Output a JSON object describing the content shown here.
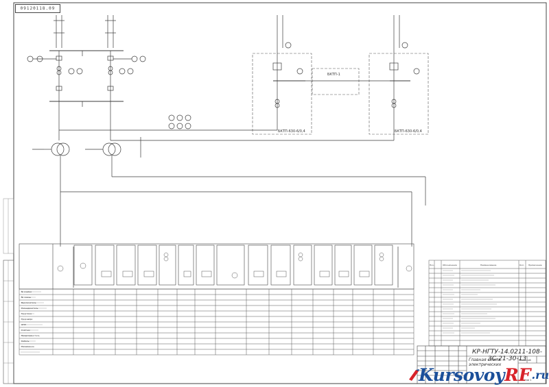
{
  "stamp": {
    "top_code": "09120118.09",
    "doc_number": "КР-НГТУ-14.0211-108-ЗС-21-30-13",
    "doc_title": "Главная схема электрических",
    "sheet_label": "Листов 1",
    "role_label": "Масштаб"
  },
  "boxes": {
    "kts_left": "БКТП-630-6/0,4",
    "kts_right": "БКТП-630-6/0,4",
    "kts_mid": "БКТП-1"
  },
  "watermark": {
    "main": "Kursovoy",
    "accent": "RF",
    "suffix": ".ru"
  },
  "spec_table": {
    "headers": [
      "Поз.",
      "Обозначение",
      "Наименование",
      "Кол.",
      "Примечание"
    ]
  },
  "panel_table": {
    "row_labels": [
      "№ ячейки",
      "№ схемы",
      "Выключатель",
      "Разъединитель",
      "Тр-р тока",
      "Тр-р напр.",
      "ОПН",
      "Счётчик",
      "Предохранитель",
      "Кабель",
      "Назначение"
    ]
  },
  "colors": {
    "line": "#3a3a3a",
    "dashed": "#555555",
    "watermark_blue": "#1b4f9a",
    "watermark_red": "#d8232a"
  }
}
